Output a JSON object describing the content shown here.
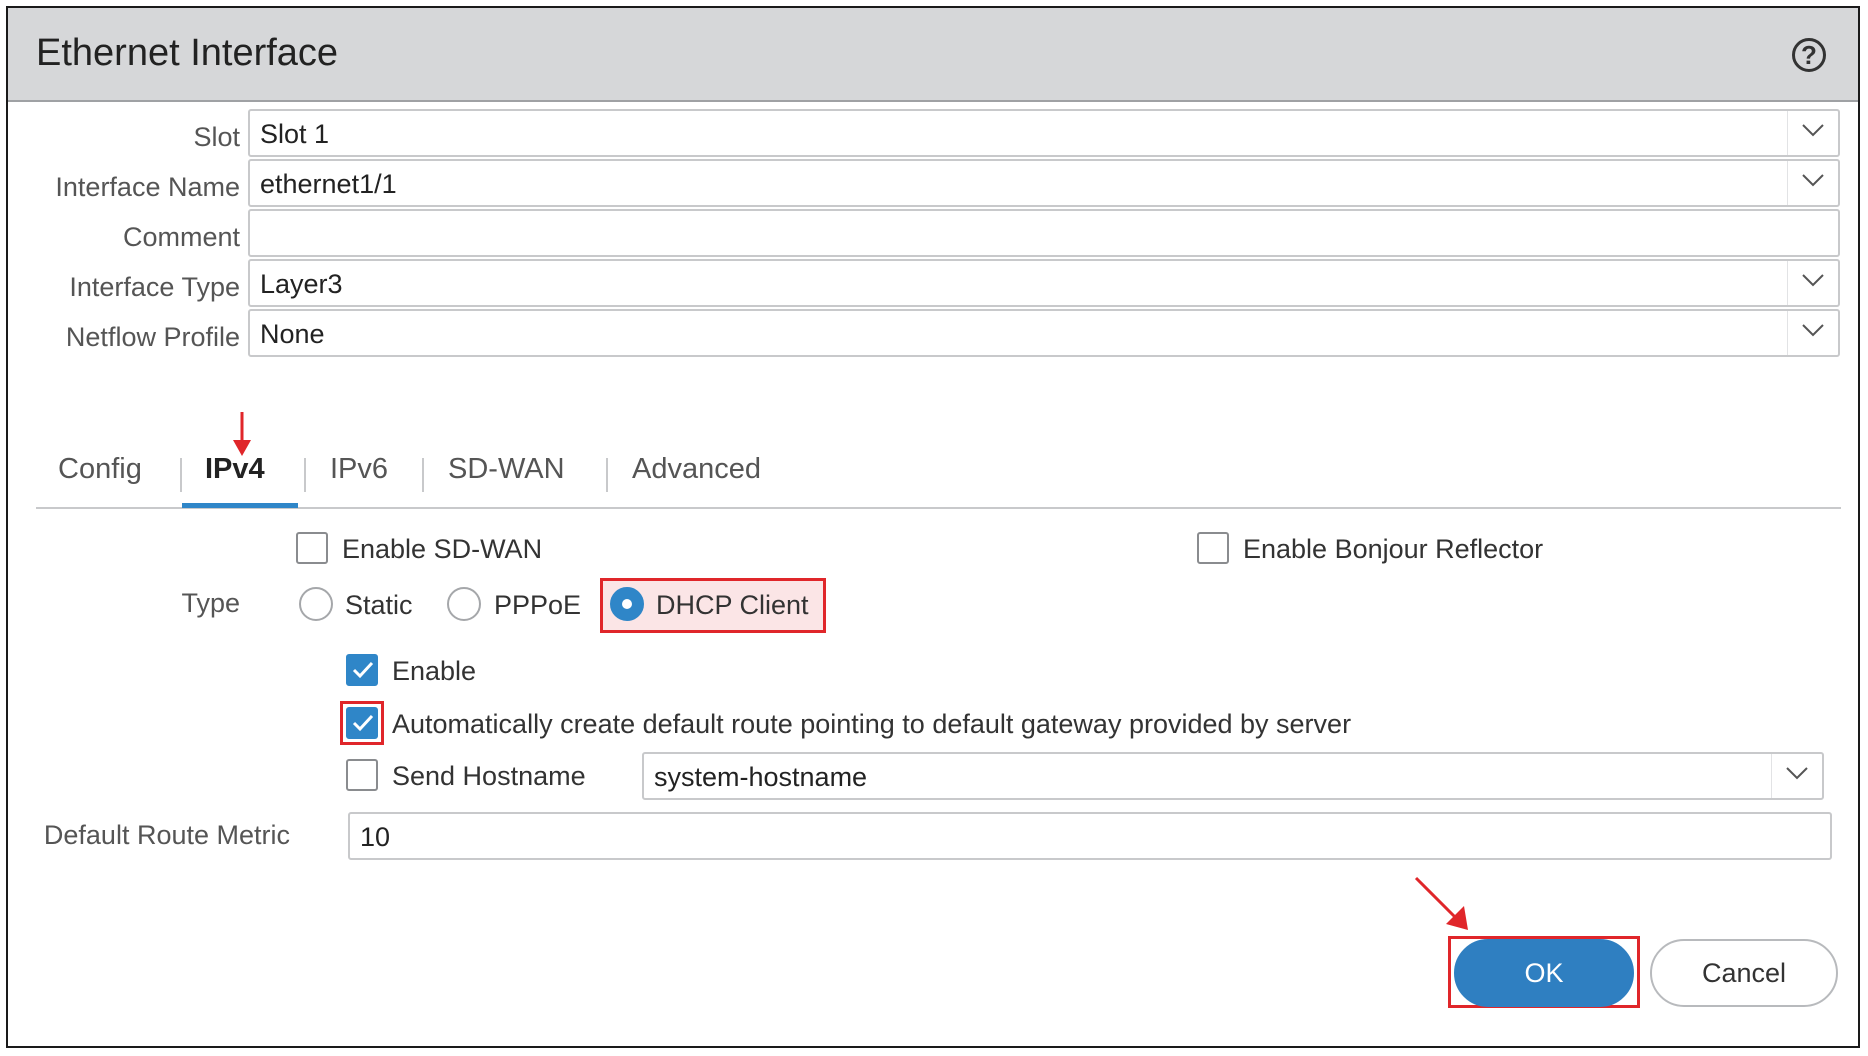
{
  "dialog": {
    "title": "Ethernet Interface",
    "help_icon": "help-circle-icon",
    "help_glyph": "?"
  },
  "form": {
    "slot": {
      "label": "Slot",
      "value": "Slot 1"
    },
    "interface_name": {
      "label": "Interface Name",
      "value": "ethernet1/1"
    },
    "comment": {
      "label": "Comment",
      "value": ""
    },
    "interface_type": {
      "label": "Interface Type",
      "value": "Layer3"
    },
    "netflow_profile": {
      "label": "Netflow Profile",
      "value": "None"
    }
  },
  "tabs": [
    {
      "label": "Config",
      "active": false
    },
    {
      "label": "IPv4",
      "active": true
    },
    {
      "label": "IPv6",
      "active": false
    },
    {
      "label": "SD-WAN",
      "active": false
    },
    {
      "label": "Advanced",
      "active": false
    }
  ],
  "ipv4": {
    "enable_sdwan": {
      "label": "Enable SD-WAN",
      "checked": false
    },
    "enable_bonjour": {
      "label": "Enable Bonjour Reflector",
      "checked": false
    },
    "type": {
      "label": "Type",
      "options": [
        {
          "label": "Static",
          "selected": false
        },
        {
          "label": "PPPoE",
          "selected": false
        },
        {
          "label": "DHCP Client",
          "selected": true
        }
      ]
    },
    "enable": {
      "label": "Enable",
      "checked": true
    },
    "auto_default_route": {
      "label": "Automatically create default route pointing to default gateway provided by server",
      "checked": true
    },
    "send_hostname": {
      "label": "Send Hostname",
      "checked": false,
      "value": "system-hostname"
    },
    "default_route_metric": {
      "label": "Default Route Metric",
      "value": "10"
    }
  },
  "buttons": {
    "ok": "OK",
    "cancel": "Cancel"
  },
  "colors": {
    "accent": "#2f86c8",
    "highlight": "#e0262a",
    "titlebar": "#d6d7d9"
  }
}
